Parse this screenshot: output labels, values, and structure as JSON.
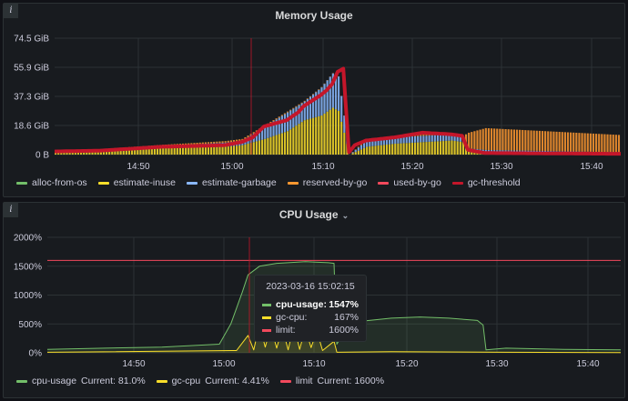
{
  "memory_panel": {
    "title": "Memory Usage",
    "info_icon": "i",
    "legend": [
      {
        "name": "alloc-from-os",
        "color": "#73bf69"
      },
      {
        "name": "estimate-inuse",
        "color": "#fade2a"
      },
      {
        "name": "estimate-garbage",
        "color": "#8ab8ff"
      },
      {
        "name": "reserved-by-go",
        "color": "#ff9830"
      },
      {
        "name": "used-by-go",
        "color": "#f2495c"
      },
      {
        "name": "gc-threshold",
        "color": "#c4162a"
      }
    ]
  },
  "cpu_panel": {
    "title": "CPU Usage",
    "chevron": "⌄",
    "info_icon": "i",
    "legend": [
      {
        "name": "cpu-usage",
        "current": "Current: 81.0%",
        "color": "#73bf69"
      },
      {
        "name": "gc-cpu",
        "current": "Current: 4.41%",
        "color": "#fade2a"
      },
      {
        "name": "limit",
        "current": "Current: 1600%",
        "color": "#f2495c"
      }
    ],
    "tooltip": {
      "time": "2023-03-16 15:02:15",
      "rows": [
        {
          "name": "cpu-usage:",
          "value": "1547%",
          "color": "#73bf69",
          "bold": true
        },
        {
          "name": "gc-cpu:",
          "value": "167%",
          "color": "#fade2a",
          "bold": false
        },
        {
          "name": "limit:",
          "value": "1600%",
          "color": "#f2495c",
          "bold": false
        }
      ]
    }
  },
  "chart_data": [
    {
      "type": "bar",
      "title": "Memory Usage",
      "yticks": [
        "74.5 GiB",
        "55.9 GiB",
        "37.3 GiB",
        "18.6 GiB",
        "0 B"
      ],
      "xticks": [
        "14:50",
        "15:00",
        "15:10",
        "15:20",
        "15:30",
        "15:40"
      ],
      "ylim": [
        0,
        74.5
      ],
      "series": [
        {
          "name": "estimate-inuse",
          "points": [
            [
              0,
              1.5
            ],
            [
              0.08,
              2
            ],
            [
              0.19,
              4
            ],
            [
              0.3,
              5
            ],
            [
              0.33,
              6
            ],
            [
              0.37,
              10
            ],
            [
              0.41,
              15
            ],
            [
              0.44,
              22
            ],
            [
              0.47,
              25
            ],
            [
              0.49,
              30
            ],
            [
              0.5,
              28
            ],
            [
              0.52,
              0
            ],
            [
              0.55,
              5
            ],
            [
              0.6,
              7
            ],
            [
              0.65,
              8
            ],
            [
              0.7,
              9
            ],
            [
              0.72,
              8
            ],
            [
              0.73,
              3
            ],
            [
              0.76,
              2
            ],
            [
              1.0,
              1
            ]
          ]
        },
        {
          "name": "estimate-garbage",
          "points": [
            [
              0,
              0.5
            ],
            [
              0.19,
              1.5
            ],
            [
              0.33,
              3
            ],
            [
              0.37,
              8
            ],
            [
              0.41,
              12
            ],
            [
              0.44,
              12
            ],
            [
              0.47,
              18
            ],
            [
              0.49,
              22
            ],
            [
              0.5,
              22
            ],
            [
              0.52,
              0
            ],
            [
              0.55,
              4
            ],
            [
              0.6,
              4
            ],
            [
              0.7,
              4
            ],
            [
              0.72,
              3
            ],
            [
              0.73,
              1
            ],
            [
              1.0,
              0.5
            ]
          ]
        },
        {
          "name": "reserved-by-go",
          "points": [
            [
              0,
              0.5
            ],
            [
              0.33,
              1
            ],
            [
              0.52,
              0
            ],
            [
              0.55,
              1
            ],
            [
              0.72,
              1
            ],
            [
              0.73,
              10
            ],
            [
              0.76,
              14
            ],
            [
              1.0,
              11
            ]
          ]
        },
        {
          "name": "gc-threshold",
          "points": [
            [
              0,
              2
            ],
            [
              0.08,
              2.5
            ],
            [
              0.19,
              5
            ],
            [
              0.3,
              6
            ],
            [
              0.33,
              8
            ],
            [
              0.35,
              11
            ],
            [
              0.37,
              18
            ],
            [
              0.41,
              22
            ],
            [
              0.43,
              27
            ],
            [
              0.44,
              31
            ],
            [
              0.47,
              38
            ],
            [
              0.48,
              41
            ],
            [
              0.49,
              45
            ],
            [
              0.5,
              53
            ],
            [
              0.51,
              55
            ],
            [
              0.52,
              1.5
            ],
            [
              0.53,
              6
            ],
            [
              0.55,
              9
            ],
            [
              0.6,
              11
            ],
            [
              0.65,
              14
            ],
            [
              0.7,
              13
            ],
            [
              0.72,
              12
            ],
            [
              0.73,
              3
            ],
            [
              0.76,
              1
            ],
            [
              1.0,
              0.5
            ]
          ]
        }
      ]
    },
    {
      "type": "line",
      "title": "CPU Usage",
      "yticks": [
        "2000%",
        "1500%",
        "1000%",
        "500%",
        "0%"
      ],
      "xticks": [
        "14:50",
        "15:00",
        "15:10",
        "15:20",
        "15:30",
        "15:40"
      ],
      "ylim": [
        0,
        2000
      ],
      "series": [
        {
          "name": "cpu-usage",
          "points": [
            [
              0,
              60
            ],
            [
              0.1,
              80
            ],
            [
              0.2,
              100
            ],
            [
              0.3,
              150
            ],
            [
              0.32,
              500
            ],
            [
              0.34,
              1050
            ],
            [
              0.35,
              1350
            ],
            [
              0.37,
              1500
            ],
            [
              0.4,
              1550
            ],
            [
              0.45,
              1580
            ],
            [
              0.49,
              1560
            ],
            [
              0.5,
              1550
            ],
            [
              0.505,
              150
            ],
            [
              0.52,
              400
            ],
            [
              0.55,
              550
            ],
            [
              0.6,
              600
            ],
            [
              0.65,
              620
            ],
            [
              0.7,
              600
            ],
            [
              0.75,
              560
            ],
            [
              0.76,
              480
            ],
            [
              0.765,
              50
            ],
            [
              0.8,
              80
            ],
            [
              0.9,
              60
            ],
            [
              1.0,
              50
            ]
          ]
        },
        {
          "name": "gc-cpu",
          "points": [
            [
              0,
              10
            ],
            [
              0.33,
              40
            ],
            [
              0.35,
              300
            ],
            [
              0.36,
              50
            ],
            [
              0.37,
              500
            ],
            [
              0.38,
              100
            ],
            [
              0.39,
              450
            ],
            [
              0.4,
              80
            ],
            [
              0.41,
              430
            ],
            [
              0.42,
              50
            ],
            [
              0.43,
              480
            ],
            [
              0.44,
              60
            ],
            [
              0.45,
              420
            ],
            [
              0.46,
              90
            ],
            [
              0.47,
              380
            ],
            [
              0.48,
              40
            ],
            [
              0.5,
              200
            ],
            [
              0.505,
              10
            ],
            [
              0.6,
              20
            ],
            [
              0.8,
              10
            ],
            [
              1.0,
              5
            ]
          ]
        },
        {
          "name": "limit",
          "points": [
            [
              0,
              1600
            ],
            [
              1.0,
              1600
            ]
          ]
        }
      ]
    }
  ]
}
